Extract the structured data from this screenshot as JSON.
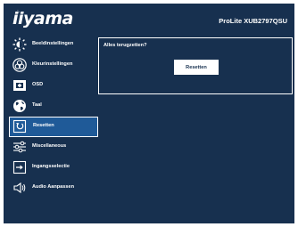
{
  "header": {
    "logo": "iiyama",
    "model": "ProLite XUB2797QSU"
  },
  "sidebar": {
    "items": [
      {
        "label": "Beeldinstellingen",
        "icon": "brightness-icon"
      },
      {
        "label": "Kleurinstellingen",
        "icon": "color-palette-icon"
      },
      {
        "label": "OSD",
        "icon": "osd-icon"
      },
      {
        "label": "Taal",
        "icon": "globe-icon"
      },
      {
        "label": "Resetten",
        "icon": "reset-icon",
        "active": true
      },
      {
        "label": "Miscellaneous",
        "icon": "sliders-icon"
      },
      {
        "label": "Ingangsselectie",
        "icon": "input-icon"
      },
      {
        "label": "Audio Aanpassen",
        "icon": "speaker-icon"
      }
    ]
  },
  "panel": {
    "title": "Alles terugzetten?",
    "button_label": "Resetten"
  },
  "colors": {
    "background": "#17304f",
    "active_item": "#1f5a98",
    "text": "#ffffff"
  }
}
